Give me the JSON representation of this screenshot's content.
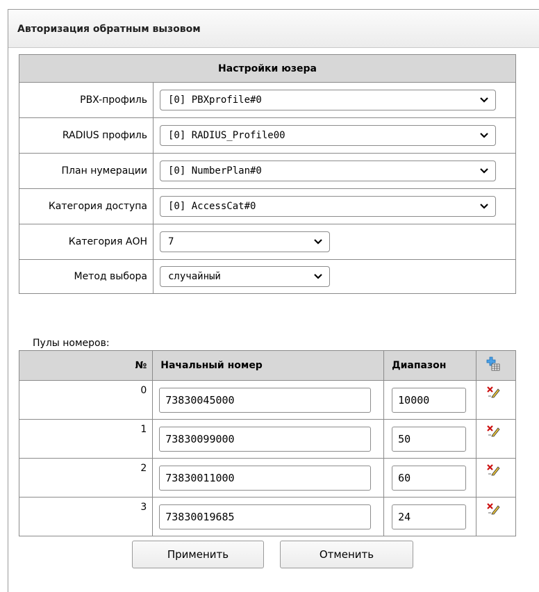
{
  "panel": {
    "title": "Авторизация обратным вызовом"
  },
  "settings": {
    "header": "Настройки юзера",
    "rows": [
      {
        "label": "PBX-профиль",
        "value": "[0] PBXprofile#0"
      },
      {
        "label": "RADIUS профиль",
        "value": "[0] RADIUS_Profile00"
      },
      {
        "label": "План нумерации",
        "value": "[0] NumberPlan#0"
      },
      {
        "label": "Категория доступа",
        "value": "[0] AccessCat#0"
      },
      {
        "label": "Категория АОН",
        "value": "7"
      },
      {
        "label": "Метод выбора",
        "value": "случайный"
      }
    ]
  },
  "pools": {
    "label": "Пулы номеров:",
    "columns": {
      "num": "№",
      "start": "Начальный номер",
      "range": "Диапазон",
      "add_icon": "add-row-icon"
    },
    "rows": [
      {
        "num": "0",
        "start": "73830045000",
        "range": "10000"
      },
      {
        "num": "1",
        "start": "73830099000",
        "range": "50"
      },
      {
        "num": "2",
        "start": "73830011000",
        "range": "60"
      },
      {
        "num": "3",
        "start": "73830019685",
        "range": "24"
      }
    ],
    "row_action_icon": "delete-edit-icon"
  },
  "buttons": {
    "apply": "Применить",
    "cancel": "Отменить"
  }
}
